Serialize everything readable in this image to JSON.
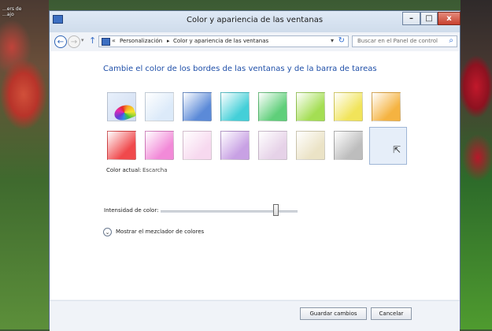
{
  "desktop": {
    "icon_label": "...ers de\n...ajo"
  },
  "window": {
    "title": "Color y apariencia de las ventanas",
    "buttons": {
      "minimize": "–",
      "maximize": "□",
      "close": "x"
    }
  },
  "nav": {
    "back_icon": "back-arrow-icon",
    "forward_icon": "forward-arrow-icon",
    "address": {
      "separator": "«",
      "crumbs": [
        "Personalización",
        "Color y apariencia de las ventanas"
      ],
      "arrow": "▸"
    },
    "search_placeholder": "Buscar en el Panel de control"
  },
  "content": {
    "heading": "Cambie el color de los bordes de las ventanas y de la barra de tareas",
    "swatches_row1": [
      "auto",
      "#dceaf9",
      "#5b8ad8",
      "#44cfd8",
      "#5fcf7a",
      "#a4de53",
      "#f1e45a",
      "#f5b341"
    ],
    "swatches_row2": [
      "#f0494c",
      "#f28ad8",
      "#f7d9ef",
      "#c8a1e4",
      "#e6d2e8",
      "#ebe3c6",
      "#bdbdbd",
      "#ffffff"
    ],
    "current_label": "Color actual:",
    "current_value": "Escarcha",
    "intensity_label": "Intensidad de color:",
    "intensity_value": 0.84,
    "mixer_label": "Mostrar el mezclador de colores"
  },
  "footer": {
    "save": "Guardar cambios",
    "cancel": "Cancelar"
  }
}
